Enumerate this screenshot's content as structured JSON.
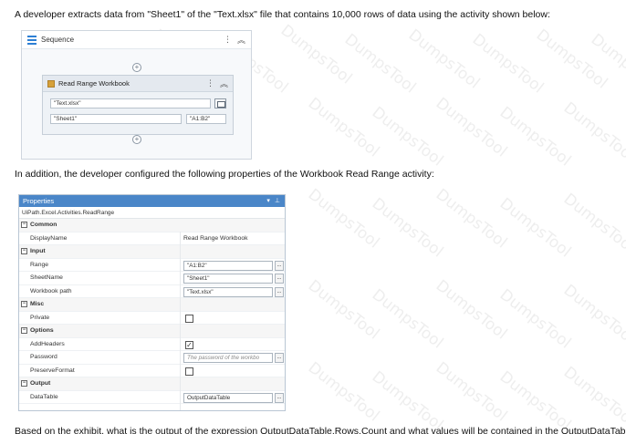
{
  "question": {
    "intro": "A developer extracts data from \"Sheet1\" of the \"Text.xlsx\" file that contains 10,000 rows of data using the activity shown below:",
    "middle": "In addition, the developer configured the following properties of the Workbook Read Range activity:",
    "bottom_partial": "Based on the exhibit, what is the output of the expression OutputDataTable.Rows.Count and what values will be contained in the OutputDataTable?"
  },
  "sequence": {
    "title": "Sequence",
    "activity": {
      "title": "Read Range Workbook",
      "workbook_path": "\"Text.xlsx\"",
      "sheet_name": "\"Sheet1\"",
      "range": "\"A1:B2\""
    }
  },
  "properties": {
    "title": "Properties",
    "type_name": "UiPath.Excel.Activities.ReadRange",
    "categories": [
      {
        "name": "Common",
        "rows": [
          {
            "name": "DisplayName",
            "value": "Read Range Workbook",
            "kind": "text"
          }
        ]
      },
      {
        "name": "Input",
        "rows": [
          {
            "name": "Range",
            "value": "\"A1:B2\"",
            "kind": "box"
          },
          {
            "name": "SheetName",
            "value": "\"Sheet1\"",
            "kind": "box"
          },
          {
            "name": "Workbook path",
            "value": "\"Text.xlsx\"",
            "kind": "box"
          }
        ]
      },
      {
        "name": "Misc",
        "rows": [
          {
            "name": "Private",
            "checked": false,
            "kind": "check"
          }
        ]
      },
      {
        "name": "Options",
        "rows": [
          {
            "name": "AddHeaders",
            "checked": true,
            "kind": "check"
          },
          {
            "name": "Password",
            "value": "The password of the workbo",
            "kind": "placeholder"
          },
          {
            "name": "PreserveFormat",
            "checked": false,
            "kind": "check"
          }
        ]
      },
      {
        "name": "Output",
        "rows": [
          {
            "name": "DataTable",
            "value": "OutputDataTable",
            "kind": "box"
          }
        ]
      }
    ]
  },
  "watermark": "DumpsTool",
  "colors": {
    "title_bar": "#4a86c8",
    "excel_icon": "#d6a13a"
  }
}
